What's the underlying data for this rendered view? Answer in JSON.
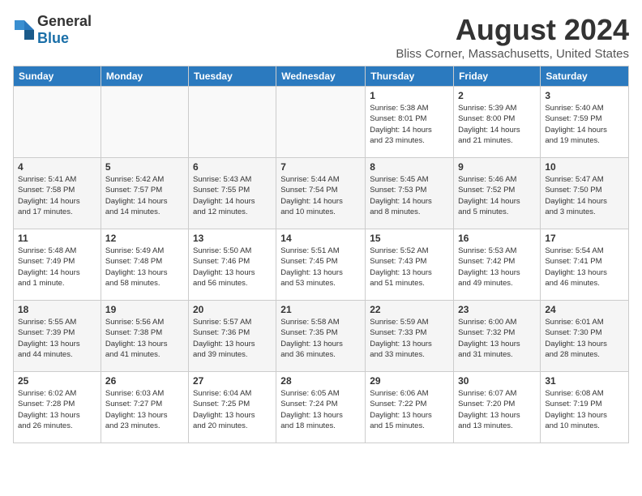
{
  "logo": {
    "general": "General",
    "blue": "Blue"
  },
  "header": {
    "month": "August 2024",
    "location": "Bliss Corner, Massachusetts, United States"
  },
  "weekdays": [
    "Sunday",
    "Monday",
    "Tuesday",
    "Wednesday",
    "Thursday",
    "Friday",
    "Saturday"
  ],
  "weeks": [
    [
      {
        "day": "",
        "info": ""
      },
      {
        "day": "",
        "info": ""
      },
      {
        "day": "",
        "info": ""
      },
      {
        "day": "",
        "info": ""
      },
      {
        "day": "1",
        "info": "Sunrise: 5:38 AM\nSunset: 8:01 PM\nDaylight: 14 hours\nand 23 minutes."
      },
      {
        "day": "2",
        "info": "Sunrise: 5:39 AM\nSunset: 8:00 PM\nDaylight: 14 hours\nand 21 minutes."
      },
      {
        "day": "3",
        "info": "Sunrise: 5:40 AM\nSunset: 7:59 PM\nDaylight: 14 hours\nand 19 minutes."
      }
    ],
    [
      {
        "day": "4",
        "info": "Sunrise: 5:41 AM\nSunset: 7:58 PM\nDaylight: 14 hours\nand 17 minutes."
      },
      {
        "day": "5",
        "info": "Sunrise: 5:42 AM\nSunset: 7:57 PM\nDaylight: 14 hours\nand 14 minutes."
      },
      {
        "day": "6",
        "info": "Sunrise: 5:43 AM\nSunset: 7:55 PM\nDaylight: 14 hours\nand 12 minutes."
      },
      {
        "day": "7",
        "info": "Sunrise: 5:44 AM\nSunset: 7:54 PM\nDaylight: 14 hours\nand 10 minutes."
      },
      {
        "day": "8",
        "info": "Sunrise: 5:45 AM\nSunset: 7:53 PM\nDaylight: 14 hours\nand 8 minutes."
      },
      {
        "day": "9",
        "info": "Sunrise: 5:46 AM\nSunset: 7:52 PM\nDaylight: 14 hours\nand 5 minutes."
      },
      {
        "day": "10",
        "info": "Sunrise: 5:47 AM\nSunset: 7:50 PM\nDaylight: 14 hours\nand 3 minutes."
      }
    ],
    [
      {
        "day": "11",
        "info": "Sunrise: 5:48 AM\nSunset: 7:49 PM\nDaylight: 14 hours\nand 1 minute."
      },
      {
        "day": "12",
        "info": "Sunrise: 5:49 AM\nSunset: 7:48 PM\nDaylight: 13 hours\nand 58 minutes."
      },
      {
        "day": "13",
        "info": "Sunrise: 5:50 AM\nSunset: 7:46 PM\nDaylight: 13 hours\nand 56 minutes."
      },
      {
        "day": "14",
        "info": "Sunrise: 5:51 AM\nSunset: 7:45 PM\nDaylight: 13 hours\nand 53 minutes."
      },
      {
        "day": "15",
        "info": "Sunrise: 5:52 AM\nSunset: 7:43 PM\nDaylight: 13 hours\nand 51 minutes."
      },
      {
        "day": "16",
        "info": "Sunrise: 5:53 AM\nSunset: 7:42 PM\nDaylight: 13 hours\nand 49 minutes."
      },
      {
        "day": "17",
        "info": "Sunrise: 5:54 AM\nSunset: 7:41 PM\nDaylight: 13 hours\nand 46 minutes."
      }
    ],
    [
      {
        "day": "18",
        "info": "Sunrise: 5:55 AM\nSunset: 7:39 PM\nDaylight: 13 hours\nand 44 minutes."
      },
      {
        "day": "19",
        "info": "Sunrise: 5:56 AM\nSunset: 7:38 PM\nDaylight: 13 hours\nand 41 minutes."
      },
      {
        "day": "20",
        "info": "Sunrise: 5:57 AM\nSunset: 7:36 PM\nDaylight: 13 hours\nand 39 minutes."
      },
      {
        "day": "21",
        "info": "Sunrise: 5:58 AM\nSunset: 7:35 PM\nDaylight: 13 hours\nand 36 minutes."
      },
      {
        "day": "22",
        "info": "Sunrise: 5:59 AM\nSunset: 7:33 PM\nDaylight: 13 hours\nand 33 minutes."
      },
      {
        "day": "23",
        "info": "Sunrise: 6:00 AM\nSunset: 7:32 PM\nDaylight: 13 hours\nand 31 minutes."
      },
      {
        "day": "24",
        "info": "Sunrise: 6:01 AM\nSunset: 7:30 PM\nDaylight: 13 hours\nand 28 minutes."
      }
    ],
    [
      {
        "day": "25",
        "info": "Sunrise: 6:02 AM\nSunset: 7:28 PM\nDaylight: 13 hours\nand 26 minutes."
      },
      {
        "day": "26",
        "info": "Sunrise: 6:03 AM\nSunset: 7:27 PM\nDaylight: 13 hours\nand 23 minutes."
      },
      {
        "day": "27",
        "info": "Sunrise: 6:04 AM\nSunset: 7:25 PM\nDaylight: 13 hours\nand 20 minutes."
      },
      {
        "day": "28",
        "info": "Sunrise: 6:05 AM\nSunset: 7:24 PM\nDaylight: 13 hours\nand 18 minutes."
      },
      {
        "day": "29",
        "info": "Sunrise: 6:06 AM\nSunset: 7:22 PM\nDaylight: 13 hours\nand 15 minutes."
      },
      {
        "day": "30",
        "info": "Sunrise: 6:07 AM\nSunset: 7:20 PM\nDaylight: 13 hours\nand 13 minutes."
      },
      {
        "day": "31",
        "info": "Sunrise: 6:08 AM\nSunset: 7:19 PM\nDaylight: 13 hours\nand 10 minutes."
      }
    ]
  ]
}
